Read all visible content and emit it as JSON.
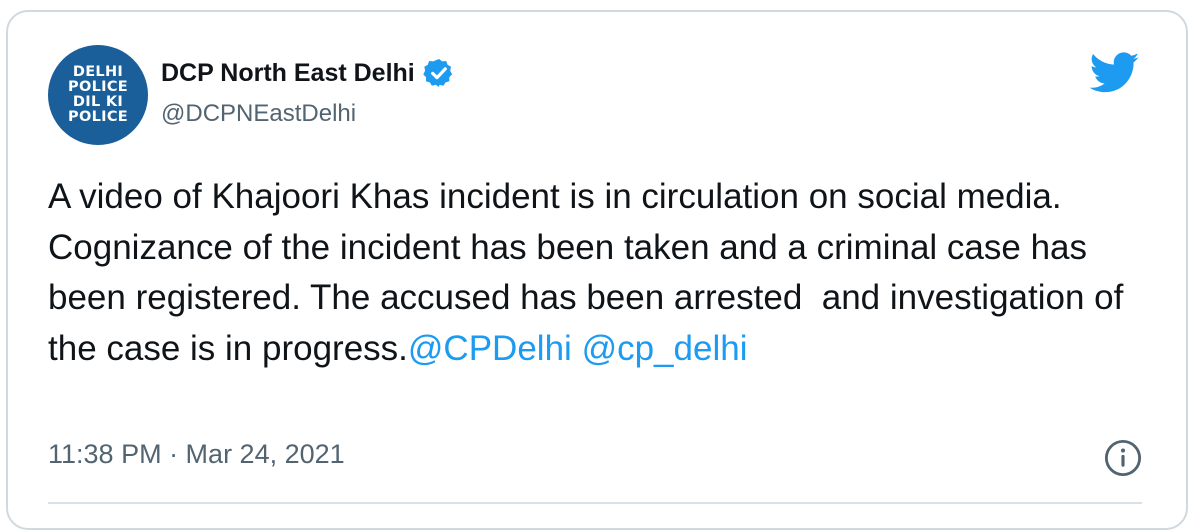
{
  "tweet": {
    "avatar_lines": [
      "DELHI",
      "POLICE",
      "DIL KI",
      "POLICE"
    ],
    "display_name": "DCP North East Delhi",
    "handle": "@DCPNEastDelhi",
    "text": "A video of Khajoori Khas incident is in circulation on social media. Cognizance of the incident has been taken and a criminal case has been registered. The accused has been arrested  and investigation of the case is in progress.",
    "mentions": [
      "@CPDelhi",
      "@cp_delhi"
    ],
    "timestamp": "11:38 PM · Mar 24, 2021"
  },
  "icons": {
    "verified": "verified-badge-icon",
    "platform": "twitter-bird-icon",
    "info": "info-icon"
  },
  "colors": {
    "accent": "#1d9bf0",
    "text": "#0f1419",
    "secondary": "#536471",
    "avatar_bg": "#1a5e9a"
  }
}
